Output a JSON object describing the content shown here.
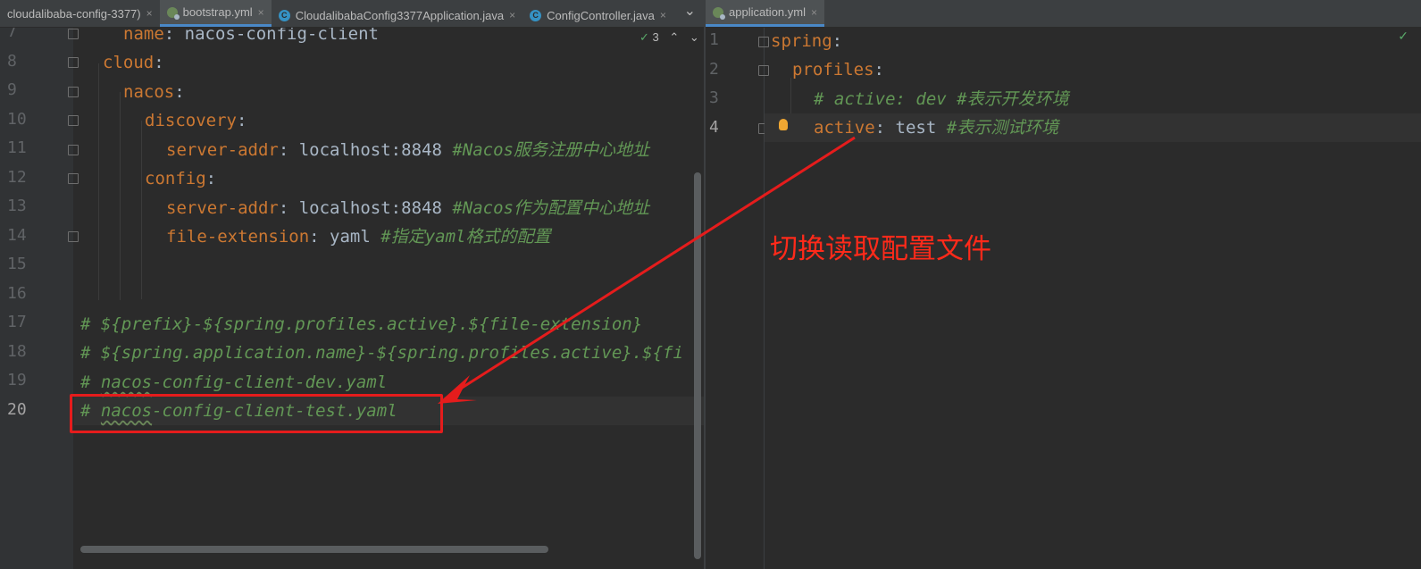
{
  "left_tabs": [
    {
      "label": "cloudalibaba-config-3377)",
      "type": "none",
      "active": false
    },
    {
      "label": "bootstrap.yml",
      "type": "yml",
      "active": true
    },
    {
      "label": "CloudalibabaConfig3377Application.java",
      "type": "java",
      "active": false
    },
    {
      "label": "ConfigController.java",
      "type": "java",
      "active": false
    }
  ],
  "right_tabs": [
    {
      "label": "application.yml",
      "type": "yml",
      "active": true
    }
  ],
  "close_glyph": "×",
  "tab_overflow_glyph": "⌄",
  "inspection": {
    "check": "✓",
    "count": "3",
    "up": "⌃",
    "down": "⌄"
  },
  "right_check": "✓",
  "left_editor": {
    "line_numbers": [
      "7",
      "8",
      "9",
      "10",
      "11",
      "12",
      "13",
      "14",
      "15",
      "16",
      "17",
      "18",
      "19",
      "20"
    ],
    "lines": {
      "l7_key": "name",
      "l7_val": "nacos-config-client",
      "l8_key": "cloud",
      "l9_key": "nacos",
      "l10_key": "discovery",
      "l11_key": "server-addr",
      "l11_val": "localhost:8848",
      "l11_comment": "#Nacos服务注册中心地址",
      "l12_key": "config",
      "l13_key": "server-addr",
      "l13_val": "localhost:8848",
      "l13_comment": "#Nacos作为配置中心地址",
      "l14_key": "file-extension",
      "l14_val": "yaml",
      "l14_comment": "#指定yaml格式的配置",
      "l17": "# ${prefix}-${spring.profiles.active}.${file-extension}",
      "l18": "# ${spring.application.name}-${spring.profiles.active}.${fi",
      "l19_hash": "# ",
      "l19_sq": "nacos",
      "l19_rest": "-config-client-dev.yaml",
      "l20_hash": "# ",
      "l20_sq": "nacos",
      "l20_rest": "-config-client-test.yaml"
    }
  },
  "right_editor": {
    "line_numbers": [
      "1",
      "2",
      "3",
      "4"
    ],
    "lines": {
      "l1_key": "spring",
      "l2_key": "profiles",
      "l3_comment": "# active: dev #表示开发环境",
      "l4_key": "active",
      "l4_val": "test",
      "l4_comment": "#表示测试环境"
    }
  },
  "annotation": {
    "text": "切换读取配置文件",
    "color": "#ff2a1a"
  },
  "colors": {
    "key": "#cc7832",
    "plain": "#a9b7c6",
    "comment": "#629755",
    "bg": "#2b2b2b",
    "accent": "#4a88c7"
  }
}
